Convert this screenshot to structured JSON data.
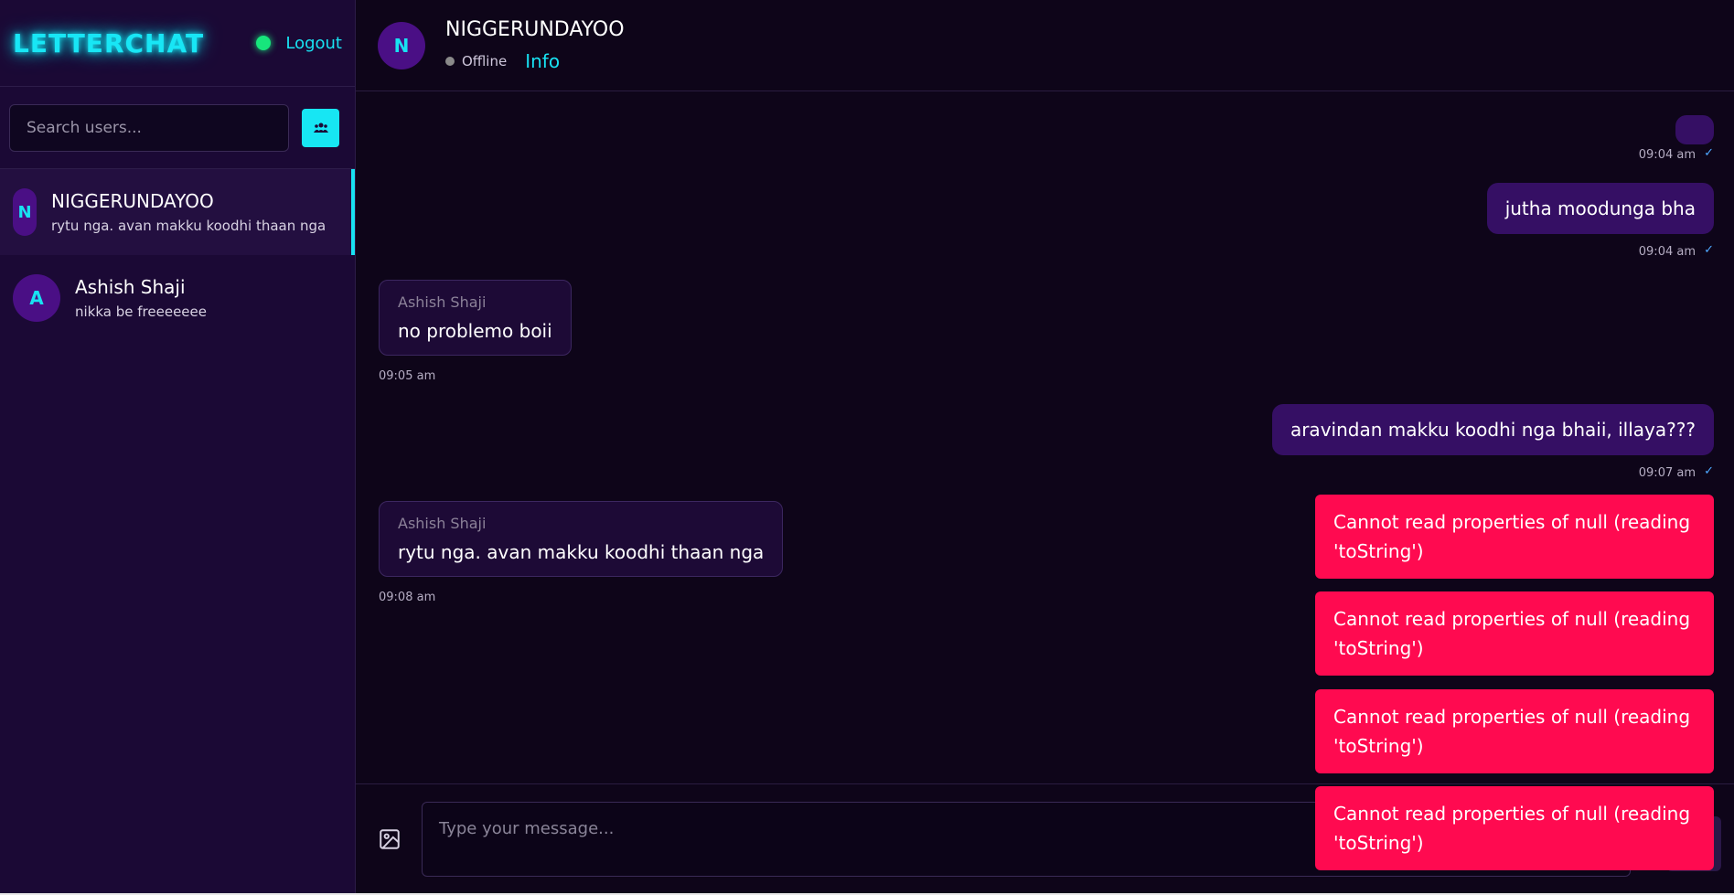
{
  "app": {
    "logo": "LETTERCHAT",
    "logout_label": "Logout"
  },
  "search": {
    "placeholder": "Search users..."
  },
  "users": [
    {
      "initial": "N",
      "name": "NIGGERUNDAYOO",
      "preview": "rytu nga. avan makku koodhi thaan nga",
      "active": true
    },
    {
      "initial": "A",
      "name": "Ashish Shaji",
      "preview": "nikka be freeeeeee",
      "active": false
    }
  ],
  "chat": {
    "initial": "N",
    "name": "NIGGERUNDAYOO",
    "status": "Offline",
    "info_label": "Info",
    "messages": [
      {
        "direction": "out",
        "sender": "",
        "text": "",
        "time": "09:04 am",
        "tick": "✓"
      },
      {
        "direction": "out",
        "sender": "",
        "text": "jutha moodunga bha",
        "time": "09:04 am",
        "tick": "✓"
      },
      {
        "direction": "in",
        "sender": "Ashish Shaji",
        "text": "no problemo boii",
        "time": "09:05 am"
      },
      {
        "direction": "out",
        "sender": "",
        "text": "aravindan makku koodhi nga bhaii, illaya???",
        "time": "09:07 am",
        "tick": "✓"
      },
      {
        "direction": "in",
        "sender": "Ashish Shaji",
        "text": "rytu nga. avan makku koodhi thaan nga",
        "time": "09:08 am"
      }
    ]
  },
  "composer": {
    "placeholder": "Type your message..."
  },
  "toasts": [
    {
      "text": "Cannot read properties of null (reading 'toString')"
    },
    {
      "text": "Cannot read properties of null (reading 'toString')"
    },
    {
      "text": "Cannot read properties of null (reading 'toString')"
    },
    {
      "text": "Cannot read properties of null (reading 'toString')"
    }
  ],
  "colors": {
    "accent": "#18e2f2",
    "sidebar_bg": "#1b0935",
    "chat_bg": "#0e0519",
    "outgoing_bubble": "#350f64",
    "incoming_bubble": "#1d0a36",
    "toast_error": "#ff0a50",
    "online": "#17e67c"
  }
}
